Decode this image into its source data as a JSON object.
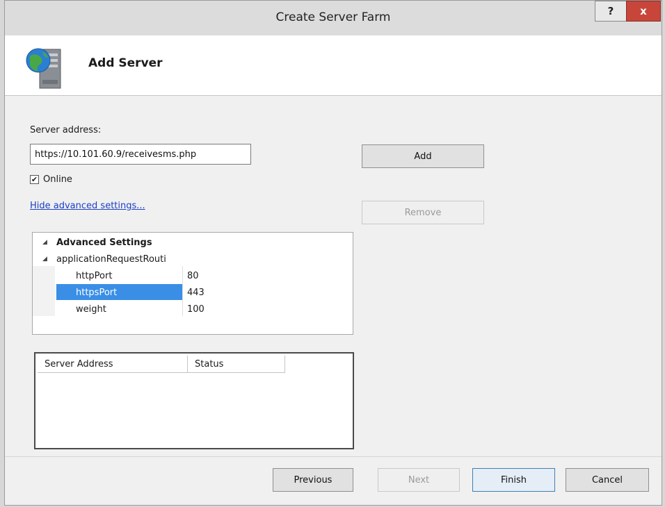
{
  "window": {
    "title": "Create Server Farm",
    "help_label": "?",
    "close_label": "x"
  },
  "header": {
    "icon": "server-globe-icon",
    "title": "Add Server"
  },
  "form": {
    "address_label": "Server address:",
    "address_value": "https://10.101.60.9/receivesms.php",
    "online_label": "Online",
    "online_checked": true,
    "advanced_link": "Hide advanced settings..."
  },
  "buttons": {
    "add": "Add",
    "remove": "Remove"
  },
  "advanced": {
    "section": "Advanced Settings",
    "group": "applicationRequestRouti",
    "rows": [
      {
        "name": "httpPort",
        "value": "80"
      },
      {
        "name": "httpsPort",
        "value": "443"
      },
      {
        "name": "weight",
        "value": "100"
      }
    ],
    "selected_row": "httpsPort"
  },
  "server_list": {
    "columns": [
      "Server Address",
      "Status"
    ],
    "rows": []
  },
  "footer": {
    "previous": "Previous",
    "next": "Next",
    "finish": "Finish",
    "cancel": "Cancel"
  },
  "colors": {
    "selection": "#3a8ee6",
    "link": "#1a3fc4",
    "close": "#c8453a"
  }
}
